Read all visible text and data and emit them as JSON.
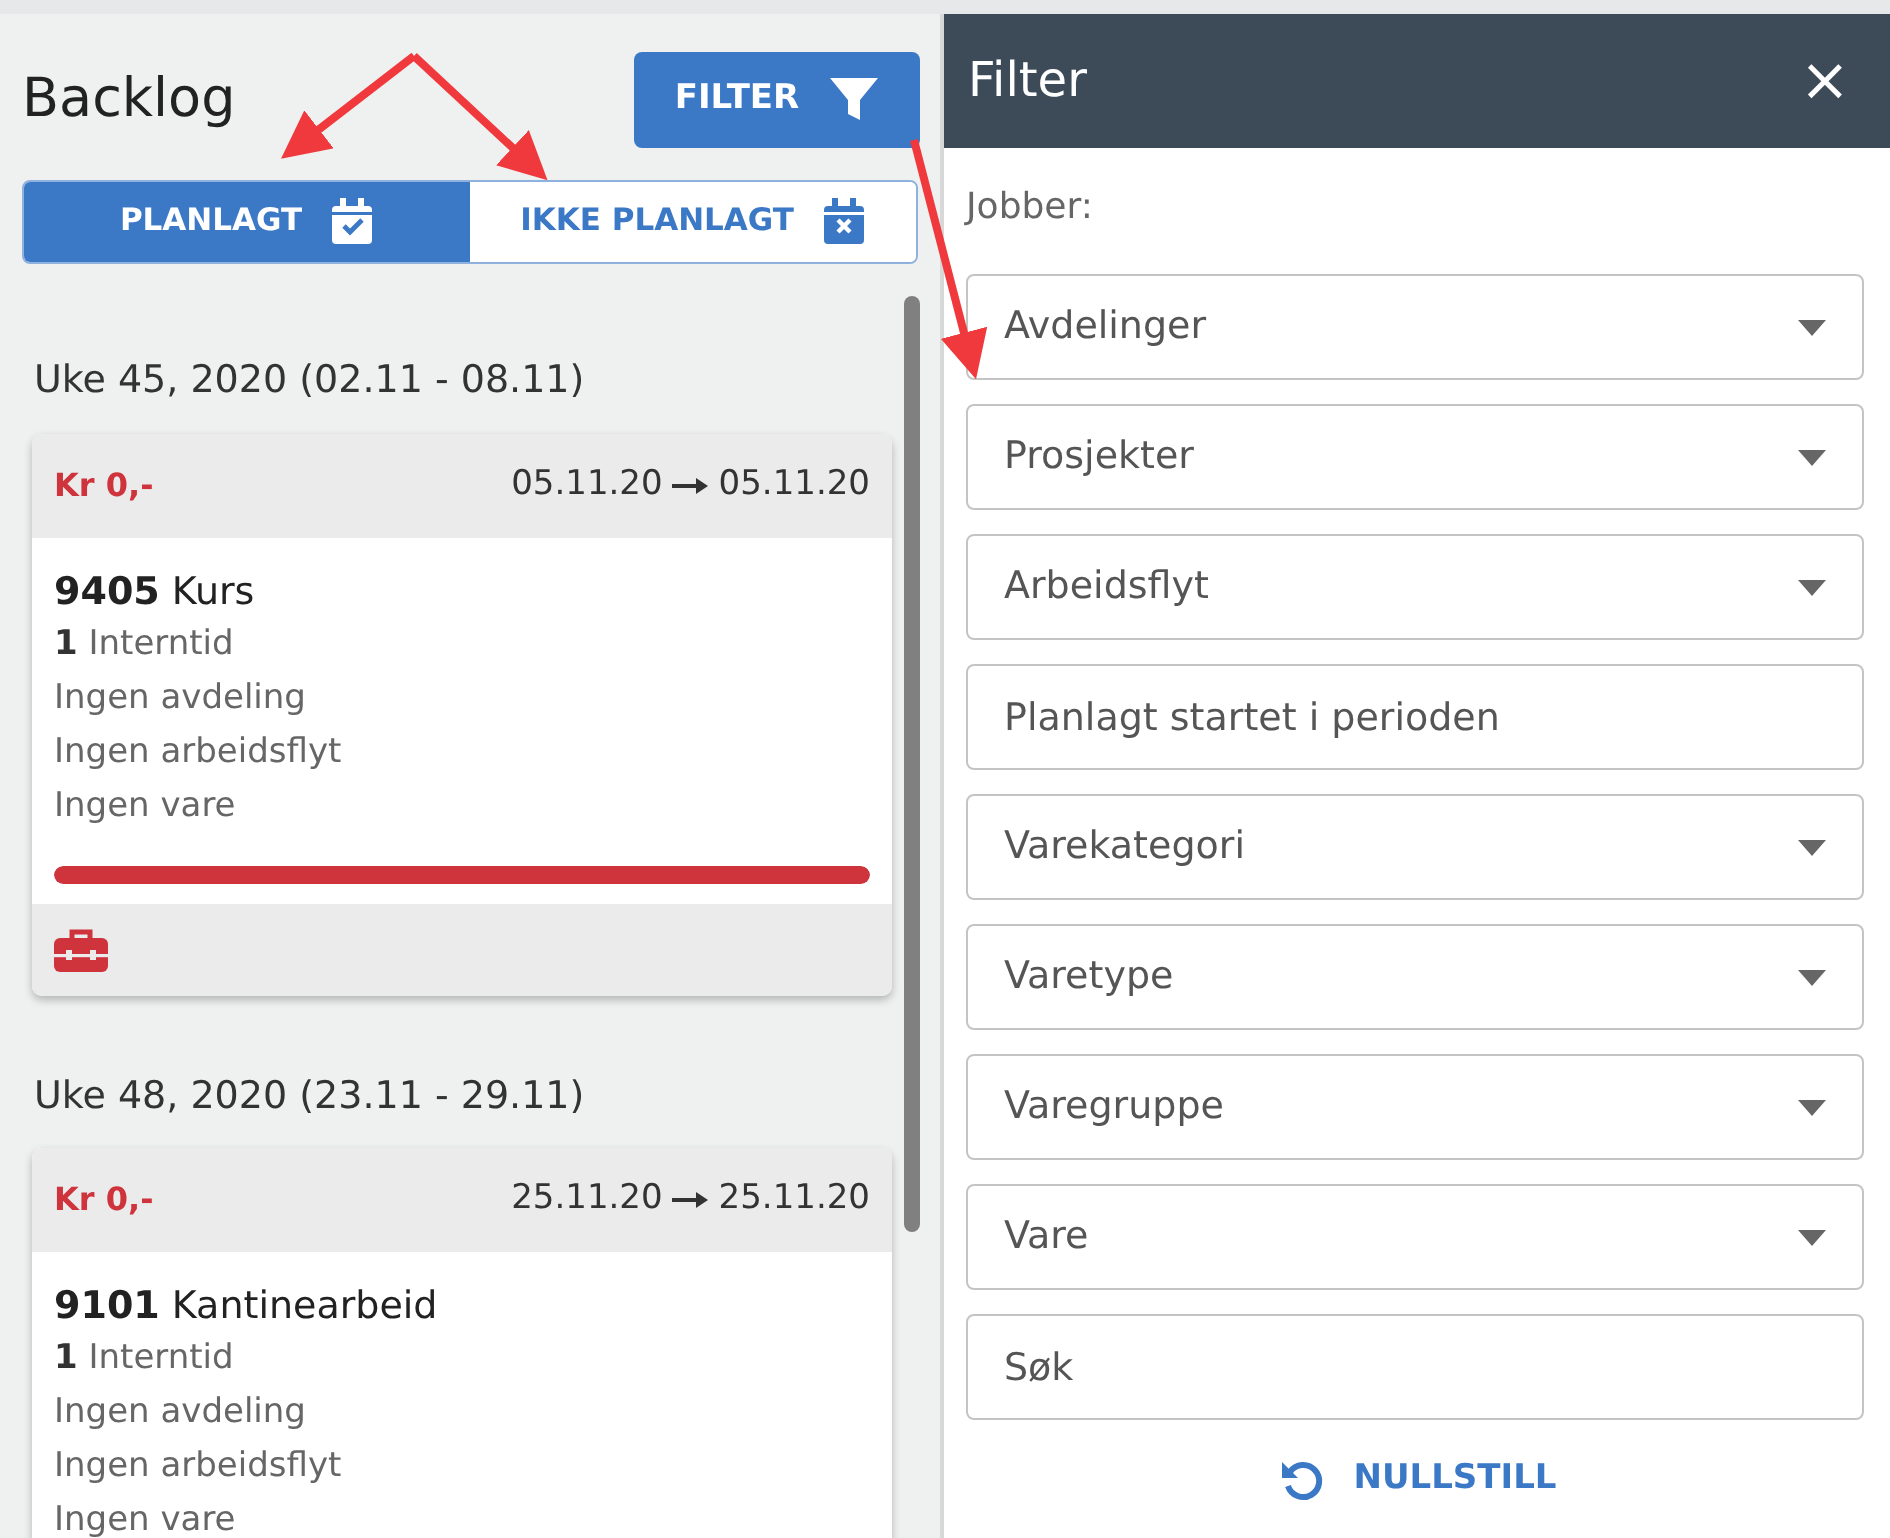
{
  "backlog": {
    "title": "Backlog",
    "filter_button": "FILTER",
    "tabs": [
      {
        "label": "PLANLAGT",
        "selected": true
      },
      {
        "label": "IKKE PLANLAGT",
        "selected": false
      }
    ],
    "weeks": [
      {
        "heading": "Uke 45, 2020 (02.11 - 08.11)",
        "jobs": [
          {
            "price": "Kr 0,-",
            "start": "05.11.20",
            "end": "05.11.20",
            "title": "**9405** Kurs",
            "lines": [
              "**1** Interntid",
              "Ingen avdeling",
              "Ingen arbeidsflyt",
              "Ingen vare"
            ],
            "level": 1,
            "tools": true
          }
        ]
      },
      {
        "heading": "Uke 48, 2020 (23.11 - 29.11)",
        "jobs": [
          {
            "price": "Kr 0,-",
            "start": "25.11.20",
            "end": "25.11.20",
            "title": "**9101** Kantinearbeid",
            "lines": [
              "**1** Interntid",
              "Ingen avdeling",
              "Ingen arbeidsflyt",
              "Ingen vare"
            ]
          }
        ]
      }
    ]
  },
  "filter_panel": {
    "title": "Filter",
    "close": "×",
    "section_label": "Jobber:",
    "fields": [
      {
        "kind": "select",
        "placeholder": "Avdelinger"
      },
      {
        "kind": "select",
        "placeholder": "Prosjekter"
      },
      {
        "kind": "select",
        "placeholder": "Arbeidsflyt"
      },
      {
        "kind": "input",
        "placeholder": "Planlagt startet i perioden"
      },
      {
        "kind": "select",
        "placeholder": "Varekategori"
      },
      {
        "kind": "select",
        "placeholder": "Varetype"
      },
      {
        "kind": "select",
        "placeholder": "Varegruppe"
      },
      {
        "kind": "select",
        "placeholder": "Vare"
      },
      {
        "kind": "input",
        "placeholder": "Søk"
      }
    ],
    "reset_button": "NULLSTILL"
  }
}
